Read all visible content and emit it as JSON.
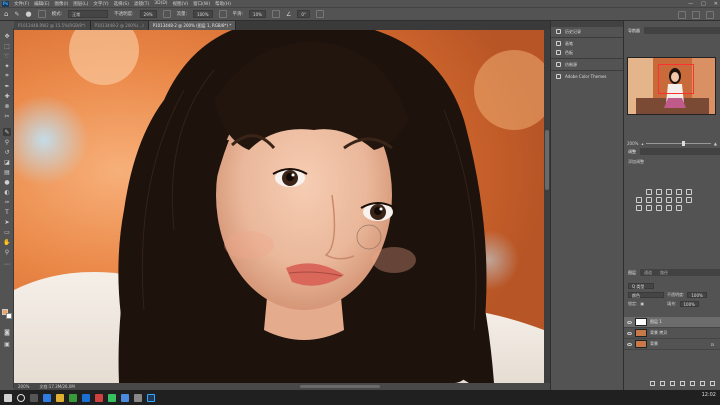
{
  "menu": {
    "app_logo": "Ps",
    "items": [
      "文件(F)",
      "编辑(E)",
      "图像(I)",
      "图层(L)",
      "文字(Y)",
      "选择(S)",
      "滤镜(T)",
      "3D(D)",
      "视图(V)",
      "窗口(W)",
      "帮助(H)"
    ],
    "window_controls": [
      "—",
      "□",
      "✕"
    ]
  },
  "options_bar": {
    "brush_size": "●",
    "mode_label": "模式:",
    "mode_value": "正常",
    "opacity_label": "不透明度:",
    "opacity_value": "29%",
    "flow_label": "流量:",
    "flow_value": "100%",
    "smooth_label": "平滑:",
    "smooth_value": "10%",
    "angle_value": "0°"
  },
  "doc_tabs": [
    {
      "label": "P1013448.RW2 @ 15.5%(RGB/8*)",
      "active": false
    },
    {
      "label": "P1013448-2 @ 200%(...)",
      "active": false
    },
    {
      "label": "P1013448-2 @ 200% (图层 1, RGB/8*) *",
      "active": true
    }
  ],
  "status": {
    "zoom": "200%",
    "doc_info": "文档:17.3M/26.0M"
  },
  "mid_panel": {
    "items": [
      {
        "icon": "history-icon",
        "label": "历史记录"
      },
      {
        "icon": "brush-icon",
        "label": "画笔"
      },
      {
        "icon": "swatches-icon",
        "label": "色板"
      },
      {
        "icon": "character-icon",
        "label": "仿制源"
      },
      {
        "icon": "themes-icon",
        "label": "Adobe Color Themes"
      }
    ]
  },
  "navigator": {
    "tabs": [
      "导航器"
    ],
    "zoom_value": "200%"
  },
  "adjustments": {
    "tabs": [
      "调整"
    ],
    "add_label": "添加调整"
  },
  "layers": {
    "tabs": [
      "图层",
      "通道",
      "路径"
    ],
    "filter_kind": "Q 类型",
    "blend_mode": "颜色",
    "opacity_label": "不透明度:",
    "opacity_value": "100%",
    "lock_label": "锁定:",
    "fill_label": "填充:",
    "fill_value": "100%",
    "items": [
      {
        "name": "图层 1",
        "active": true
      },
      {
        "name": "背景 拷贝",
        "active": false
      },
      {
        "name": "背景",
        "active": false
      }
    ]
  },
  "taskbar": {
    "time": "12:02"
  }
}
